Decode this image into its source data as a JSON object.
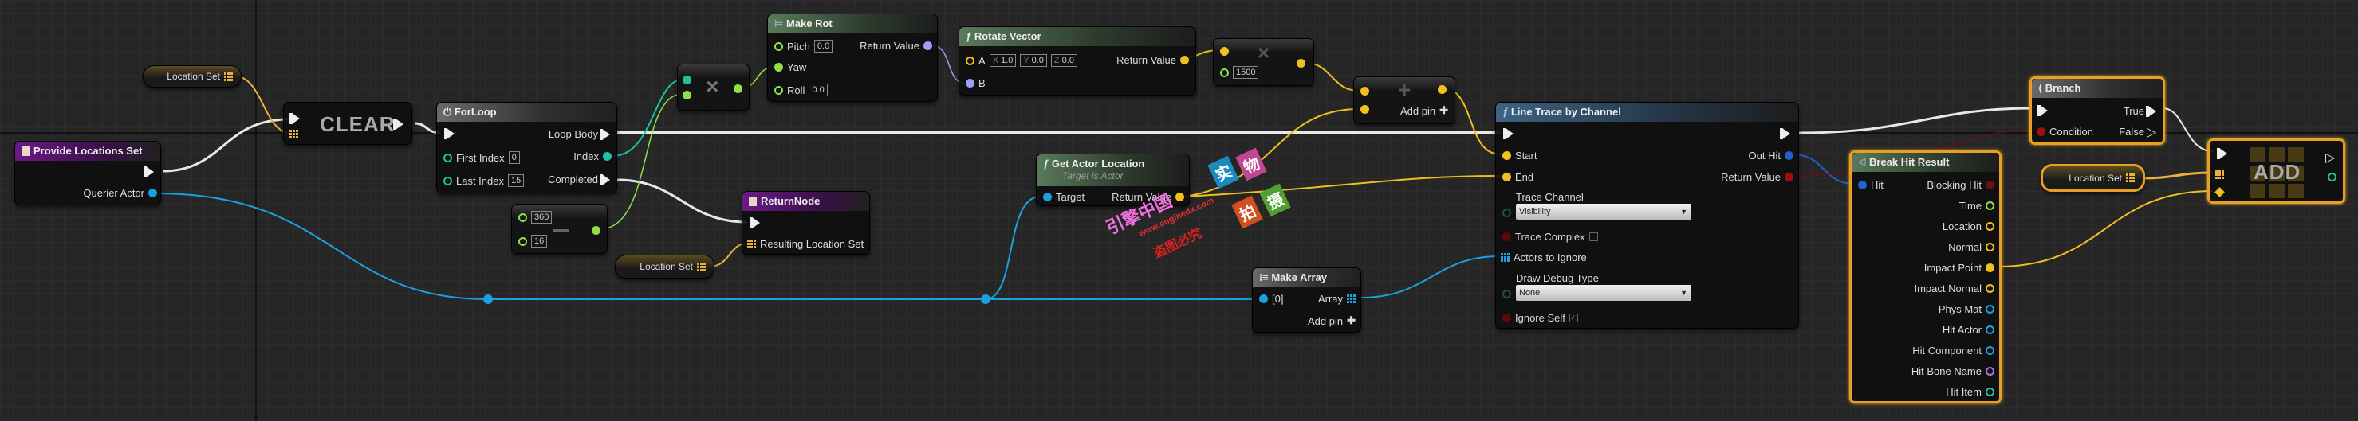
{
  "colors": {
    "exec": "#e8e8e8",
    "vector": "#f0c020",
    "object": "#1ba0e0",
    "float": "#8fe04a",
    "int": "#20c0a0",
    "set": "#e8b040",
    "bool": "#a01010",
    "selected": "#e8a024"
  },
  "nodes": {
    "provide": {
      "title": "Provide Locations Set",
      "querier": "Querier Actor"
    },
    "var_top": {
      "label": "Location Set"
    },
    "clear": {
      "label": "CLEAR"
    },
    "forloop": {
      "title": "ForLoop",
      "loop_body": "Loop Body",
      "first_index": "First Index",
      "first_value": "0",
      "last_index": "Last Index",
      "last_value": "15",
      "index": "Index",
      "completed": "Completed"
    },
    "multiply1": {
      "symbol": "×"
    },
    "divide": {
      "a": "360",
      "b": "16"
    },
    "makerot": {
      "title": "Make Rot",
      "pitch": "Pitch",
      "pitch_value": "0.0",
      "yaw": "Yaw",
      "roll": "Roll",
      "roll_value": "0.0",
      "return": "Return Value"
    },
    "rotate": {
      "title": "Rotate Vector",
      "a": "A",
      "x": "1.0",
      "y": "0.0",
      "z": "0.0",
      "b": "B",
      "return": "Return Value",
      "xl": "X",
      "yl": "Y",
      "zl": "Z"
    },
    "multiply2": {
      "value": "1500",
      "symbol": "×"
    },
    "add": {
      "add_pin": "Add pin",
      "symbol": "+"
    },
    "returnnode": {
      "title": "ReturnNode",
      "resulting": "Resulting Location Set"
    },
    "var_bottom": {
      "label": "Location Set"
    },
    "getloc": {
      "title": "Get Actor Location",
      "subtitle": "Target is Actor",
      "target": "Target",
      "return": "Return Value"
    },
    "makearray": {
      "title": "Make Array",
      "index0": "[0]",
      "array": "Array",
      "add_pin": "Add pin"
    },
    "linetrace": {
      "title": "Line Trace by Channel",
      "start": "Start",
      "end": "End",
      "trace_channel": "Trace Channel",
      "trace_channel_value": "Visibility",
      "trace_complex": "Trace Complex",
      "trace_complex_checked": false,
      "actors_to_ignore": "Actors to Ignore",
      "draw_debug_type": "Draw Debug Type",
      "draw_debug_value": "None",
      "ignore_self": "Ignore Self",
      "ignore_self_checked": true,
      "out_hit": "Out Hit",
      "return": "Return Value"
    },
    "breakhit": {
      "title": "Break Hit Result",
      "hit": "Hit",
      "outputs": [
        "Blocking Hit",
        "Time",
        "Location",
        "Normal",
        "Impact Point",
        "Impact Normal",
        "Phys Mat",
        "Hit Actor",
        "Hit Component",
        "Hit Bone Name",
        "Hit Item"
      ]
    },
    "branch": {
      "title": "Branch",
      "condition": "Condition",
      "true": "True",
      "false": "False"
    },
    "var_right": {
      "label": "Location Set"
    },
    "addset": {
      "label": "ADD"
    }
  },
  "watermark": {
    "text1": "引擎中国",
    "text2": "www.enginedx.com",
    "text3": "盗图必究",
    "tags": [
      "实",
      "物",
      "拍",
      "摄"
    ]
  }
}
